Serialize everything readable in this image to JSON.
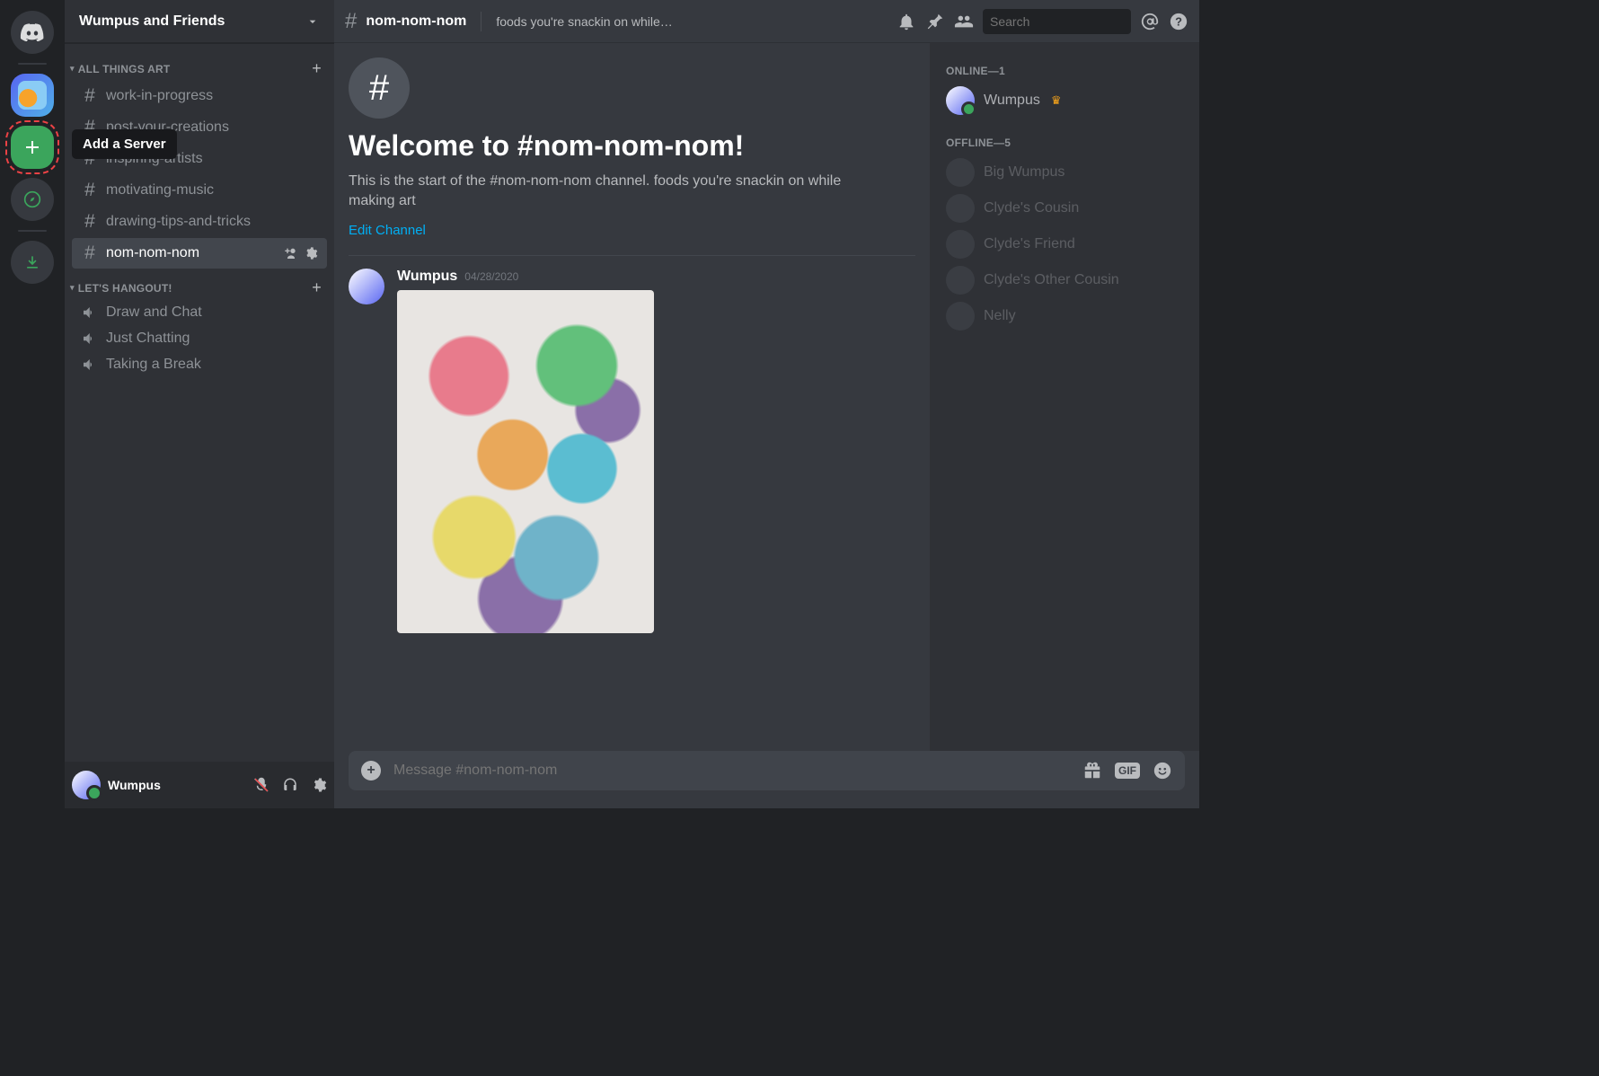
{
  "tooltip": {
    "add_server": "Add a Server"
  },
  "server": {
    "name": "Wumpus and Friends"
  },
  "categories": [
    {
      "name": "ALL THINGS ART",
      "channels": [
        {
          "type": "text",
          "name": "work-in-progress"
        },
        {
          "type": "text",
          "name": "post-your-creations"
        },
        {
          "type": "text",
          "name": "inspiring-artists"
        },
        {
          "type": "text",
          "name": "motivating-music"
        },
        {
          "type": "text",
          "name": "drawing-tips-and-tricks"
        },
        {
          "type": "text",
          "name": "nom-nom-nom",
          "selected": true
        }
      ]
    },
    {
      "name": "LET'S HANGOUT!",
      "channels": [
        {
          "type": "voice",
          "name": "Draw and Chat"
        },
        {
          "type": "voice",
          "name": "Just Chatting"
        },
        {
          "type": "voice",
          "name": "Taking a Break"
        }
      ]
    }
  ],
  "user_panel": {
    "username": "Wumpus"
  },
  "topbar": {
    "channel": "nom-nom-nom",
    "topic": "foods you're snackin on while…"
  },
  "search": {
    "placeholder": "Search"
  },
  "welcome": {
    "heading": "Welcome to #nom-nom-nom!",
    "body": "This is the start of the #nom-nom-nom channel. foods you're snackin on while making art",
    "edit": "Edit Channel"
  },
  "message": {
    "author": "Wumpus",
    "timestamp": "04/28/2020"
  },
  "composer": {
    "placeholder": "Message #nom-nom-nom"
  },
  "members": {
    "online_label": "ONLINE—1",
    "offline_label": "OFFLINE—5",
    "online": [
      {
        "name": "Wumpus",
        "owner": true
      }
    ],
    "offline": [
      {
        "name": "Big Wumpus"
      },
      {
        "name": "Clyde's Cousin"
      },
      {
        "name": "Clyde's Friend"
      },
      {
        "name": "Clyde's Other Cousin"
      },
      {
        "name": "Nelly"
      }
    ]
  },
  "icons": {
    "gif": "GIF"
  }
}
